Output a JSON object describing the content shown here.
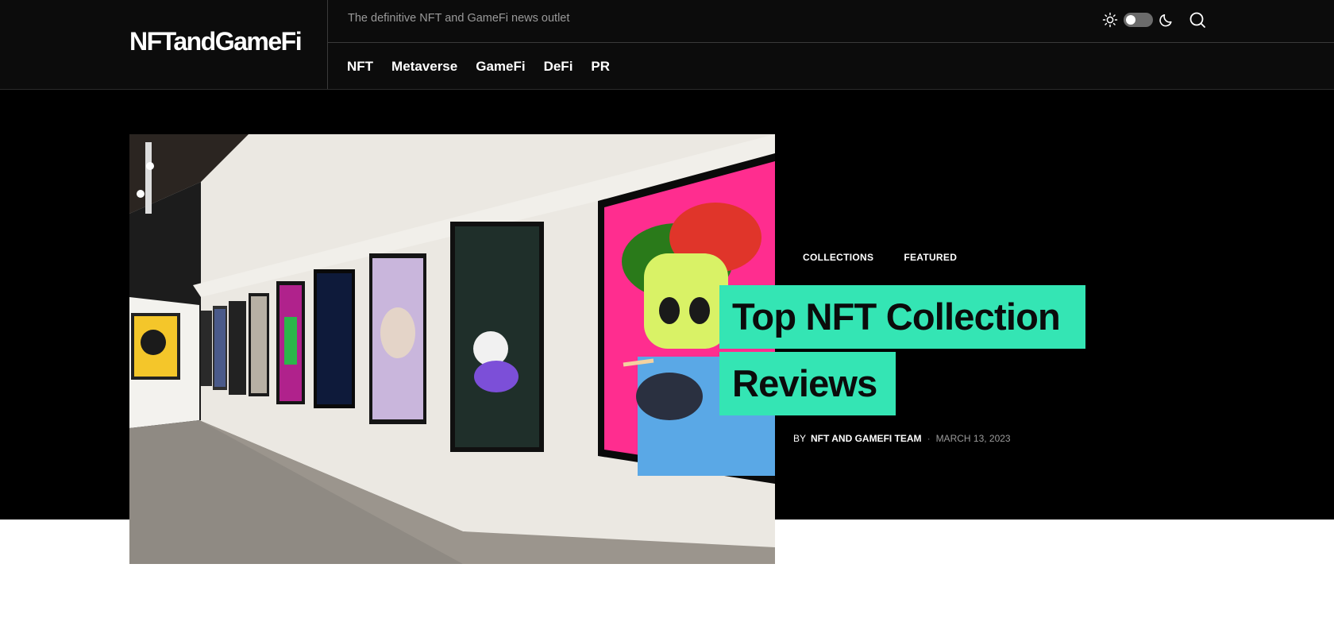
{
  "site": {
    "logo": "NFTandGameFi",
    "tagline": "The definitive NFT and GameFi news outlet"
  },
  "nav": {
    "items": [
      "NFT",
      "Metaverse",
      "GameFi",
      "DeFi",
      "PR"
    ]
  },
  "header_controls": {
    "light_icon": "sun-icon",
    "dark_icon": "moon-icon",
    "toggle_state": "off",
    "search_icon": "search-icon"
  },
  "featured": {
    "categories": [
      "COLLECTIONS",
      "FEATURED"
    ],
    "title_line1": "Top NFT Collection",
    "title_line2": "Reviews",
    "by_label": "BY",
    "author": "NFT AND GAMEFI TEAM",
    "date": "MARCH 13, 2023",
    "image_alt": "NFT gallery artwork wall"
  },
  "colors": {
    "accent": "#34e5b4",
    "header_bg": "#0c0c0c",
    "hero_bg": "#000000"
  }
}
